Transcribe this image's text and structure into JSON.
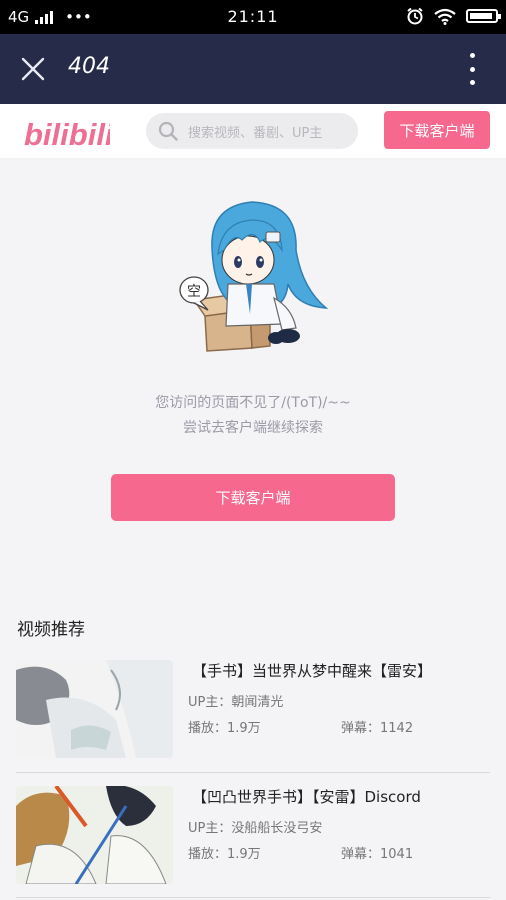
{
  "status_bar": {
    "network": "4G",
    "dots": "•••",
    "time": "21:11"
  },
  "app_bar": {
    "title": "404"
  },
  "header": {
    "logo_text": "bilibili",
    "search_placeholder": "搜索视频、番剧、UP主",
    "download_label": "下载客户端"
  },
  "main": {
    "bubble_text": "空",
    "message_line1": "您访问的页面不见了/(TоT)/~~",
    "message_line2": "尝试去客户端继续探索",
    "download_label": "下载客户端"
  },
  "recommend": {
    "heading": "视频推荐",
    "items": [
      {
        "title": "【手书】当世界从梦中醒来【雷安】",
        "up": "UP主：朝闻清光",
        "plays": "播放：1.9万",
        "danmu": "弹幕：1142"
      },
      {
        "title": "【凹凸世界手书】【安雷】Discord",
        "up": "UP主：没船船长没弓安",
        "plays": "播放：1.9万",
        "danmu": "弹幕：1041"
      }
    ]
  },
  "colors": {
    "accent": "#f7688f",
    "app_bar": "#252b49",
    "background": "#f4f3f6"
  },
  "icons": [
    "close-icon",
    "more-vertical-icon",
    "search-icon",
    "wifi-icon",
    "alarm-icon",
    "battery-icon",
    "signal-icon"
  ]
}
